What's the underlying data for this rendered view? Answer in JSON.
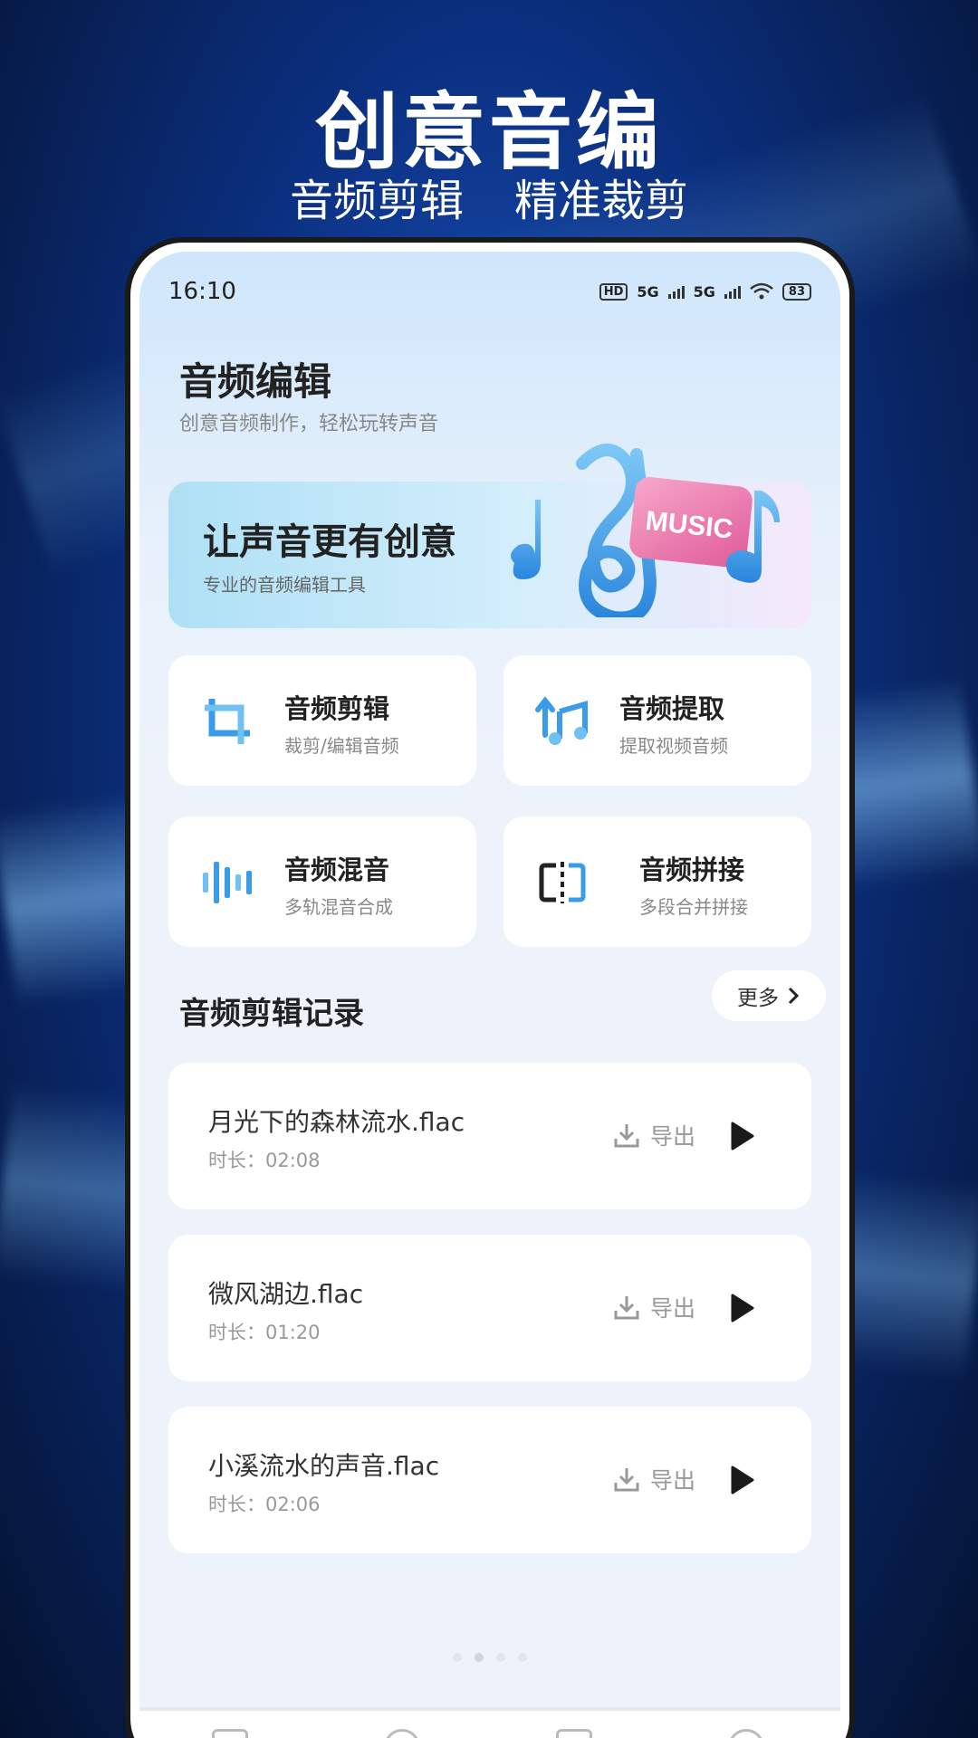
{
  "promo": {
    "title": "创意音编",
    "subtitle_left": "音频剪辑",
    "subtitle_right": "精准裁剪"
  },
  "status_bar": {
    "time": "16:10",
    "hd": "HD",
    "net1": "5G",
    "net2": "5G",
    "battery": "83"
  },
  "header": {
    "title": "音频编辑",
    "subtitle": "创意音频制作，轻松玩转声音"
  },
  "banner": {
    "title": "让声音更有创意",
    "subtitle": "专业的音频编辑工具",
    "badge": "MUSIC"
  },
  "tools": [
    {
      "title": "音频剪辑",
      "desc": "裁剪/编辑音频",
      "icon": "crop-icon"
    },
    {
      "title": "音频提取",
      "desc": "提取视频音频",
      "icon": "music-extract-icon"
    },
    {
      "title": "音频混音",
      "desc": "多轨混音合成",
      "icon": "waveform-icon"
    },
    {
      "title": "音频拼接",
      "desc": "多段合并拼接",
      "icon": "split-merge-icon"
    }
  ],
  "records_section": {
    "title": "音频剪辑记录",
    "more": "更多"
  },
  "records": [
    {
      "name": "月光下的森林流水.flac",
      "duration": "时长：02:08",
      "export": "导出"
    },
    {
      "name": "微风湖边.flac",
      "duration": "时长：01:20",
      "export": "导出"
    },
    {
      "name": "小溪流水的声音.flac",
      "duration": "时长：02:06",
      "export": "导出"
    }
  ],
  "colors": {
    "accent_blue": "#3a9be8",
    "music_pink": "#e86aa0",
    "text_primary": "#222222",
    "text_secondary": "#888888"
  }
}
